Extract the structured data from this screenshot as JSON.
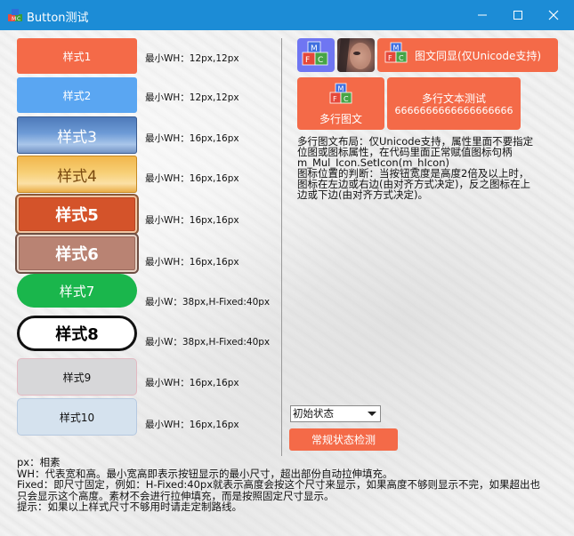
{
  "window": {
    "title": "Button测试",
    "minimize_label": "",
    "maximize_label": "",
    "close_label": ""
  },
  "left_column": {
    "buttons": [
      {
        "label": "样式1",
        "min_text": "最小WH：12px,12px"
      },
      {
        "label": "样式2",
        "min_text": "最小WH：12px,12px"
      },
      {
        "label": "样式3",
        "min_text": "最小WH：16px,16px"
      },
      {
        "label": "样式4",
        "min_text": "最小WH：16px,16px"
      },
      {
        "label": "样式5",
        "min_text": "最小WH：16px,16px"
      },
      {
        "label": "样式6",
        "min_text": "最小WH：16px,16px"
      },
      {
        "label": "样式7",
        "min_text": "最小W：38px,H-Fixed:40px"
      },
      {
        "label": "样式8",
        "min_text": "最小W：38px,H-Fixed:40px"
      },
      {
        "label": "样式9",
        "min_text": "最小WH：16px,16px"
      },
      {
        "label": "样式10",
        "min_text": "最小WH：16px,16px"
      }
    ]
  },
  "right_column": {
    "coexist_button_label": "图文同显(仅Unicode支持)",
    "multi_icon_button_label": "多行图文",
    "multi_text_button": {
      "line1": "多行文本测试",
      "line2": "6666666666666666666"
    },
    "description_lines": [
      "多行图文布局：仅Unicode支持，属性里面不要指定",
      "位图或图标属性，在代码里面正常赋值图标句柄",
      "m_Mul_Icon.SetIcon(m_hIcon)",
      "图标位置的判断：当按钮宽度是高度2倍及以上时，",
      "图标在左边或右边(由对齐方式决定)，反之图标在上",
      "边或下边(由对齐方式决定)。"
    ],
    "state_select": {
      "selected": "初始状态"
    },
    "state_check_button_label": "常规状态检测"
  },
  "footer_lines": [
    "px：相素",
    "WH：代表宽和高。最小宽高即表示按钮显示的最小尺寸，超出部份自动拉伸填充。",
    "Fixed：即尺寸固定，例如：H-Fixed:40px就表示高度会按这个尺寸来显示，如果高度不够则显示不完，如果超出也",
    "只会显示这个高度。素材不会进行拉伸填充，而是按照固定尺寸显示。",
    "提示：如果以上样式尺寸不够用时请走定制路线。"
  ],
  "colors": {
    "titlebar": "#1c8cd6",
    "accent_orange": "#f46a48",
    "accent_blue": "#5aa6f2",
    "green": "#1ab64c",
    "purple_icon_bg": "#6f76f2"
  },
  "icons": {
    "app": "mfc-cube-icon",
    "minimize": "minimize-icon",
    "maximize": "maximize-icon",
    "close": "close-icon",
    "dropdown": "chevron-down-icon"
  }
}
